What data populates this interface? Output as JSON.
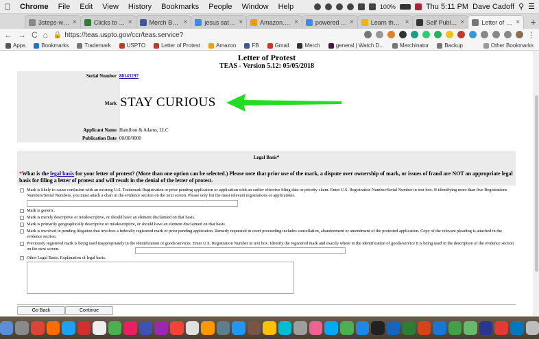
{
  "menubar": {
    "apple": "",
    "items": [
      "Chrome",
      "File",
      "Edit",
      "View",
      "History",
      "Bookmarks",
      "People",
      "Window",
      "Help"
    ],
    "battery": "100%",
    "clock": "Thu 5:11 PM",
    "user": "Dave Cadoff"
  },
  "tabs": [
    {
      "label": "3steps-websi",
      "color": "#888"
    },
    {
      "label": "Clicks to Cust",
      "color": "#2e7d32"
    },
    {
      "label": "Merch By Am",
      "color": "#3b5998"
    },
    {
      "label": "jesus satan b",
      "color": "#4285f4"
    },
    {
      "label": "Amazon.com",
      "color": "#ff9900"
    },
    {
      "label": "powered by u",
      "color": "#4285f4"
    },
    {
      "label": "Learn the Ba",
      "color": "#f4b400"
    },
    {
      "label": "Self Publishi",
      "color": "#333"
    },
    {
      "label": "Letter of Prot",
      "color": "#777",
      "active": true
    }
  ],
  "toolbar": {
    "back": "←",
    "forward": "→",
    "reload": "C",
    "home": "⌂",
    "lock": "🔒",
    "url": "https://teas.uspto.gov/ccr/teas.service?"
  },
  "bookmarks": {
    "items": [
      {
        "label": "Apps",
        "color": "#555"
      },
      {
        "label": "Bookmarks",
        "color": "#1a73e8"
      },
      {
        "label": "Trademark",
        "color": "#777"
      },
      {
        "label": "USPTO",
        "color": "#c0392b"
      },
      {
        "label": "Letter of Protest",
        "color": "#c0392b"
      },
      {
        "label": "Amazon",
        "color": "#ff9900"
      },
      {
        "label": "FB",
        "color": "#3b5998"
      },
      {
        "label": "Gmail",
        "color": "#d93025"
      },
      {
        "label": "Merch",
        "color": "#333"
      },
      {
        "label": "general | Watch D...",
        "color": "#4a154b"
      },
      {
        "label": "Merchinator",
        "color": "#777"
      },
      {
        "label": "Backup",
        "color": "#777"
      }
    ],
    "other": "Other Bookmarks"
  },
  "doc": {
    "title": "Letter of Protest",
    "subtitle": "TEAS - Version 5.12: 05/05/2018",
    "serial_label": "Serial Number",
    "serial_value": "88143297",
    "mark_label": "Mark",
    "mark_value": "STAY CURIOUS",
    "applicant_label": "Applicant Name",
    "applicant_value": "Hamilton & Adams, LLC",
    "pubdate_label": "Publication Date",
    "pubdate_value": "00/00/0000",
    "legal_head": "Legal Basis*",
    "q_star": "*",
    "q_pre": "What is the ",
    "q_link": "legal basis",
    "q_post": " for your letter of protest? (More than one option can be selected.) Please note that prior use of the mark, a dispute over ownership of mark, or issues of fraud are NOT an appropriate legal basis for filing a letter of protest and will result in the denial of the letter of protest.",
    "options": [
      "Mark is likely to cause confusion with an existing U.S. Trademark Registration or prior pending application or application with an earlier effective filing date or priority claim. Enter U.S. Registration Number/Serial Number in text box. If identifying more than five Registrations Numbers/Serial Numbers, you must attach a chart in the evidence section on the next screen. Please only list the most relevant registrations or applications.",
      "Mark is generic.",
      "Mark is merely descriptive or misdescriptive, or should have an element disclaimed on that basis.",
      "Mark is primarily geographically descriptive or misdescriptive, or should have an element disclaimed on that basis.",
      "Mark is involved in pending litigation that involves a federally registered mark or prior pending application. Remedy requested in court proceeding includes cancellation, abandonment or amendment of the protested application. Copy of the relevant pleading is attached in the evidence section.",
      "Previously registered mark is being used inappropriately in the identification of goods/services. Enter U.S. Registration Number in text box. Identify the registered mark and exactly where in the identification of goods/service it is being used in the description of the evidence section on the next screen.",
      "Other Legal Basis. Explanation of legal basis."
    ],
    "go_back": "Go Back",
    "continue": "Continue"
  },
  "colors": {
    "arrow": "#22dd22",
    "panel": "#ebebeb",
    "link": "#1a0dab"
  }
}
